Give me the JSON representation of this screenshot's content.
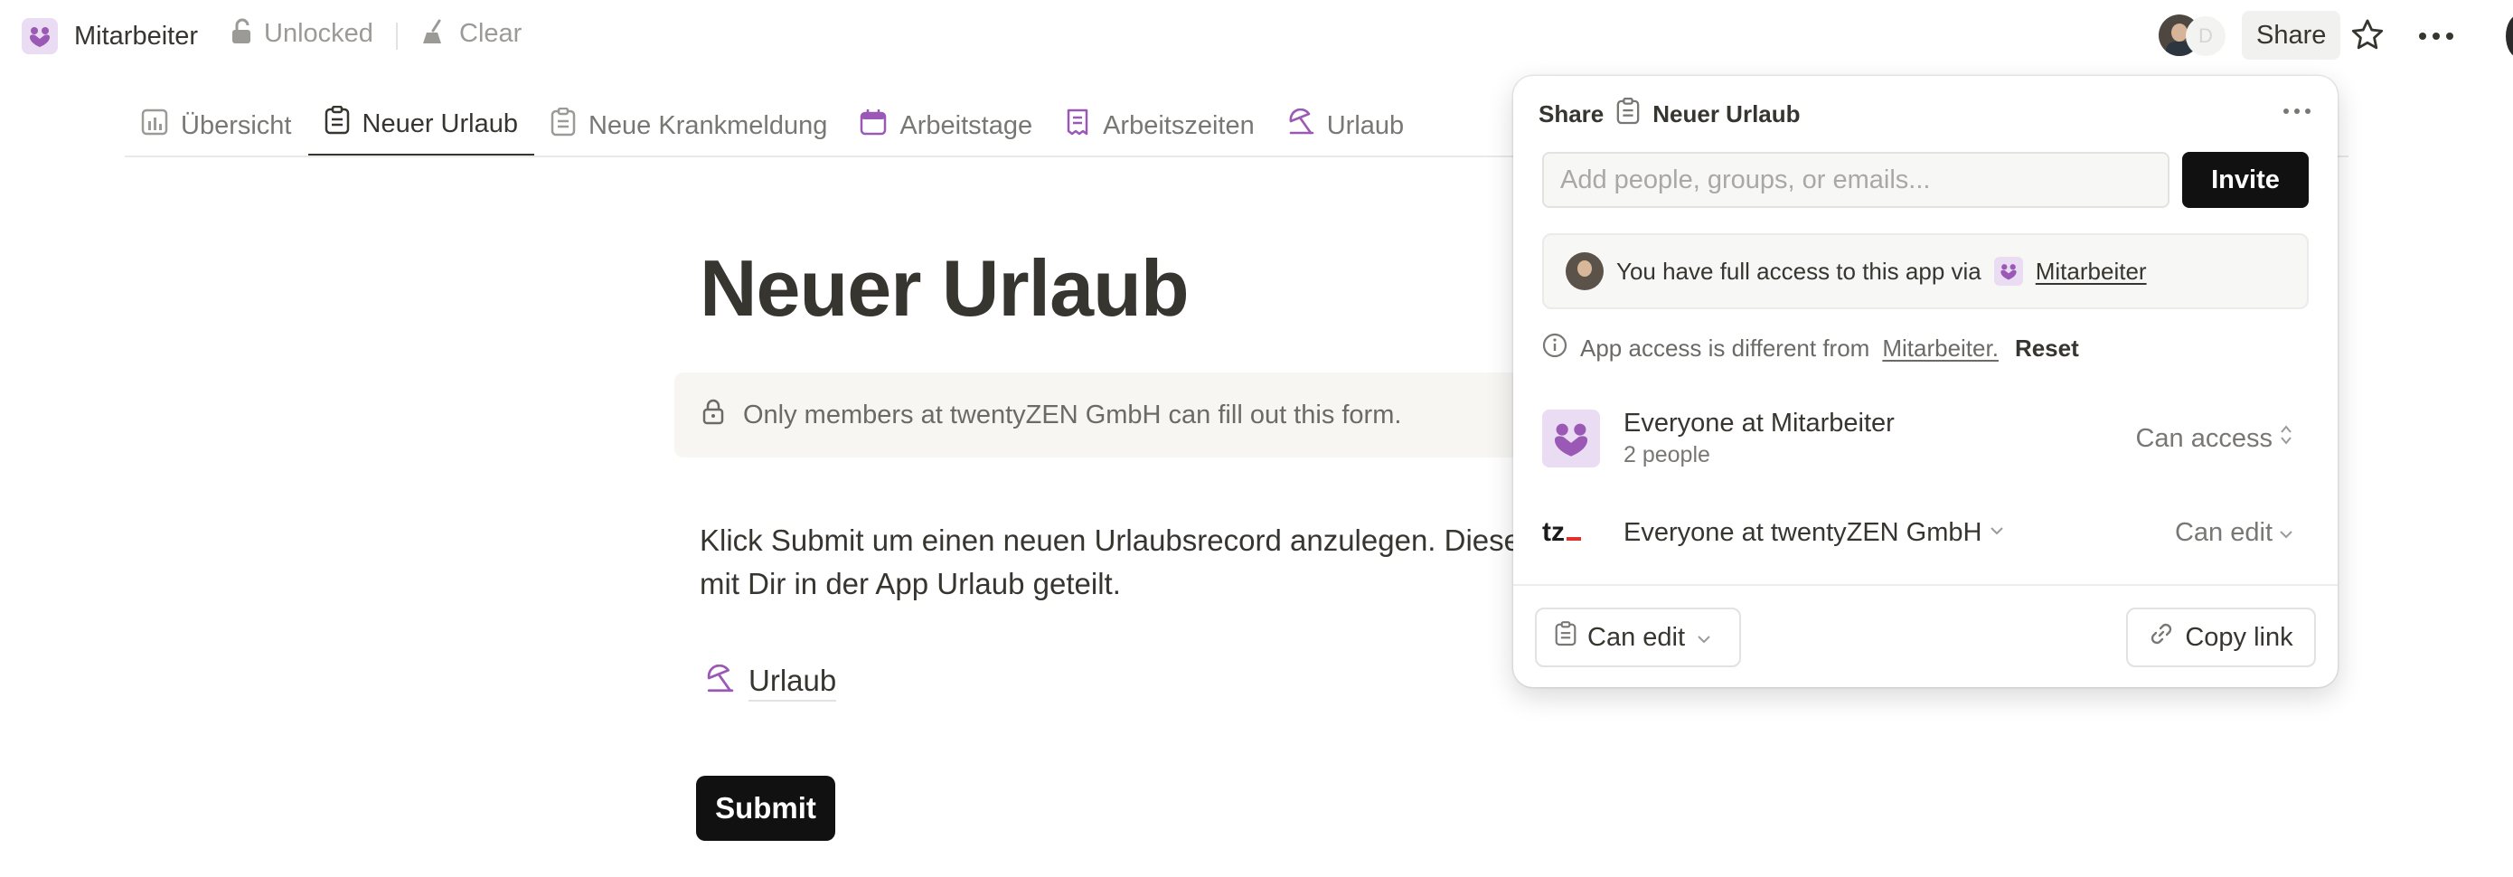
{
  "topbar": {
    "app_name": "Mitarbeiter",
    "lock_label": "Unlocked",
    "clear_label": "Clear",
    "share_label": "Share",
    "avatar_badge": "D"
  },
  "tabs": [
    {
      "label": "Übersicht",
      "icon": "chart-icon"
    },
    {
      "label": "Neuer Urlaub",
      "icon": "clipboard-icon",
      "active": true
    },
    {
      "label": "Neue Krankmeldung",
      "icon": "clipboard-icon"
    },
    {
      "label": "Arbeitstage",
      "icon": "calendar-icon"
    },
    {
      "label": "Arbeitszeiten",
      "icon": "receipt-icon"
    },
    {
      "label": "Urlaub",
      "icon": "umbrella-icon"
    }
  ],
  "form": {
    "title": "Neuer Urlaub",
    "notice": "Only members at twentyZEN GmbH can fill out this form.",
    "description_line1": "Klick Submit um einen neuen Urlaubsrecord anzulegen. Dieser",
    "description_line2": "mit Dir in der App Urlaub geteilt.",
    "field_label": "Urlaub",
    "submit_label": "Submit"
  },
  "share_popover": {
    "heading": "Share",
    "page_name": "Neuer Urlaub",
    "email_placeholder": "Add people, groups, or emails...",
    "invite_label": "Invite",
    "access_text": "You have full access to this app via",
    "access_app": "Mitarbeiter",
    "diff_text": "App access is different from",
    "diff_link": "Mitarbeiter.",
    "reset_label": "Reset",
    "groups": [
      {
        "name": "Everyone at Mitarbeiter",
        "sub": "2 people",
        "permission": "Can access"
      },
      {
        "name": "Everyone at twentyZEN GmbH",
        "logo_text": "tz",
        "permission": "Can edit"
      }
    ],
    "link_permission": "Can edit",
    "copy_link_label": "Copy link"
  },
  "colors": {
    "accent_purple": "#9b59b6",
    "button_dark": "#111111",
    "logo_red": "#e0322b"
  }
}
